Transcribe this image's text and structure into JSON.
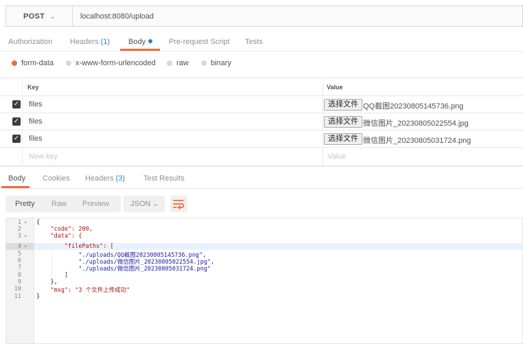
{
  "request": {
    "method": "POST",
    "url": "localhost:8080/upload"
  },
  "request_tabs": [
    {
      "label": "Authorization"
    },
    {
      "label": "Headers",
      "count": "(1)"
    },
    {
      "label": "Body"
    },
    {
      "label": "Pre-request Script"
    },
    {
      "label": "Tests"
    }
  ],
  "body_types": [
    "form-data",
    "x-www-form-urlencoded",
    "raw",
    "binary"
  ],
  "table": {
    "key_header": "Key",
    "value_header": "Value",
    "choose_file_label": "选择文件",
    "rows": [
      {
        "key": "files",
        "file": "QQ截图20230805145736.png"
      },
      {
        "key": "files",
        "file": "微信图片_20230805022554.jpg"
      },
      {
        "key": "files",
        "file": "微信图片_20230805031724.png"
      }
    ],
    "new_key_placeholder": "New key",
    "new_value_placeholder": "Value"
  },
  "response_tabs": [
    {
      "label": "Body"
    },
    {
      "label": "Cookies"
    },
    {
      "label": "Headers",
      "count": "(3)"
    },
    {
      "label": "Test Results"
    }
  ],
  "response_toolbar": {
    "formats": [
      "Pretty",
      "Raw",
      "Preview"
    ],
    "language": "JSON"
  },
  "code": {
    "line_numbers": [
      "1",
      "2",
      "3",
      "4",
      "5",
      "6",
      "7",
      "8",
      "9",
      "10",
      "11"
    ],
    "lines": [
      "{",
      "    \"code\": 200,",
      "    \"data\": {",
      "        \"filePaths\": [",
      "            \"./uploads/QQ截图20230805145736.png\",",
      "            \"./uploads/微信图片_20230805022554.jpg\",",
      "            \"./uploads/微信图片_20230805031724.png\"",
      "        ]",
      "    },",
      "    \"msg\": \"3 个文件上传成功\"",
      "}"
    ]
  },
  "colors": {
    "accent": "#f26b3a",
    "link_blue": "#2980d9"
  }
}
